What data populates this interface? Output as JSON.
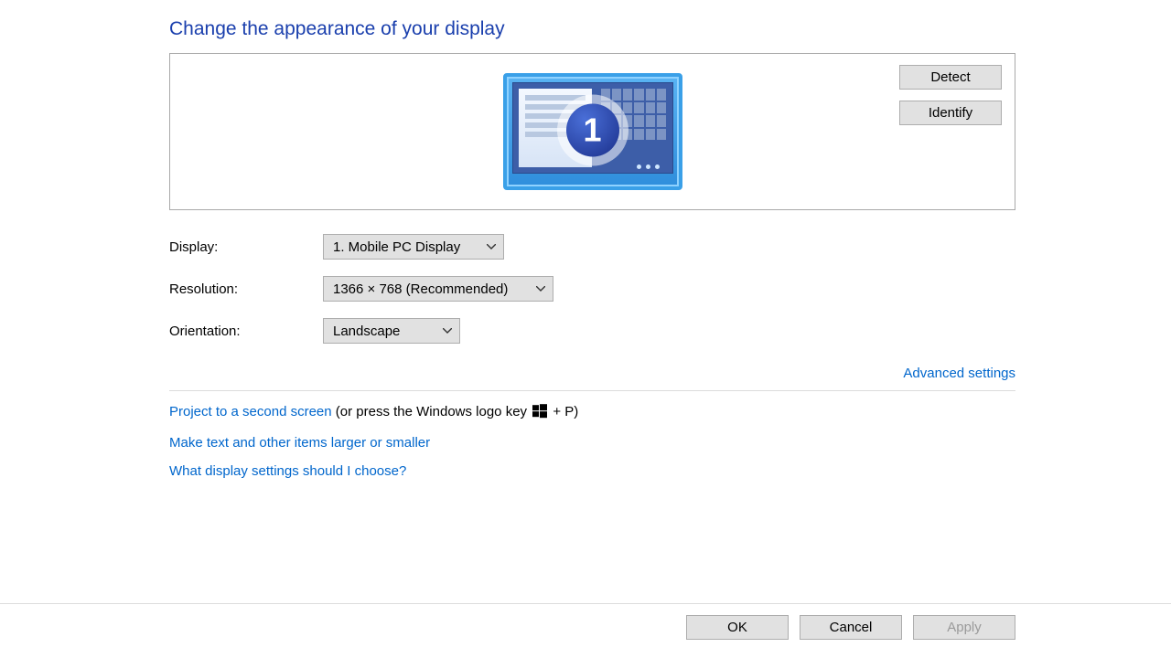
{
  "heading": "Change the appearance of your display",
  "monitor_number": "1",
  "panel": {
    "detect": "Detect",
    "identify": "Identify"
  },
  "fields": {
    "display": {
      "label": "Display:",
      "value": "1. Mobile PC Display"
    },
    "resolution": {
      "label": "Resolution:",
      "value": "1366 × 768 (Recommended)"
    },
    "orientation": {
      "label": "Orientation:",
      "value": "Landscape"
    }
  },
  "advanced": "Advanced settings",
  "links": {
    "project": "Project to a second screen",
    "project_hint_prefix": " (or press the Windows logo key ",
    "project_hint_suffix": " + P)",
    "resize": "Make text and other items larger or smaller",
    "help": "What display settings should I choose?"
  },
  "footer": {
    "ok": "OK",
    "cancel": "Cancel",
    "apply": "Apply"
  }
}
